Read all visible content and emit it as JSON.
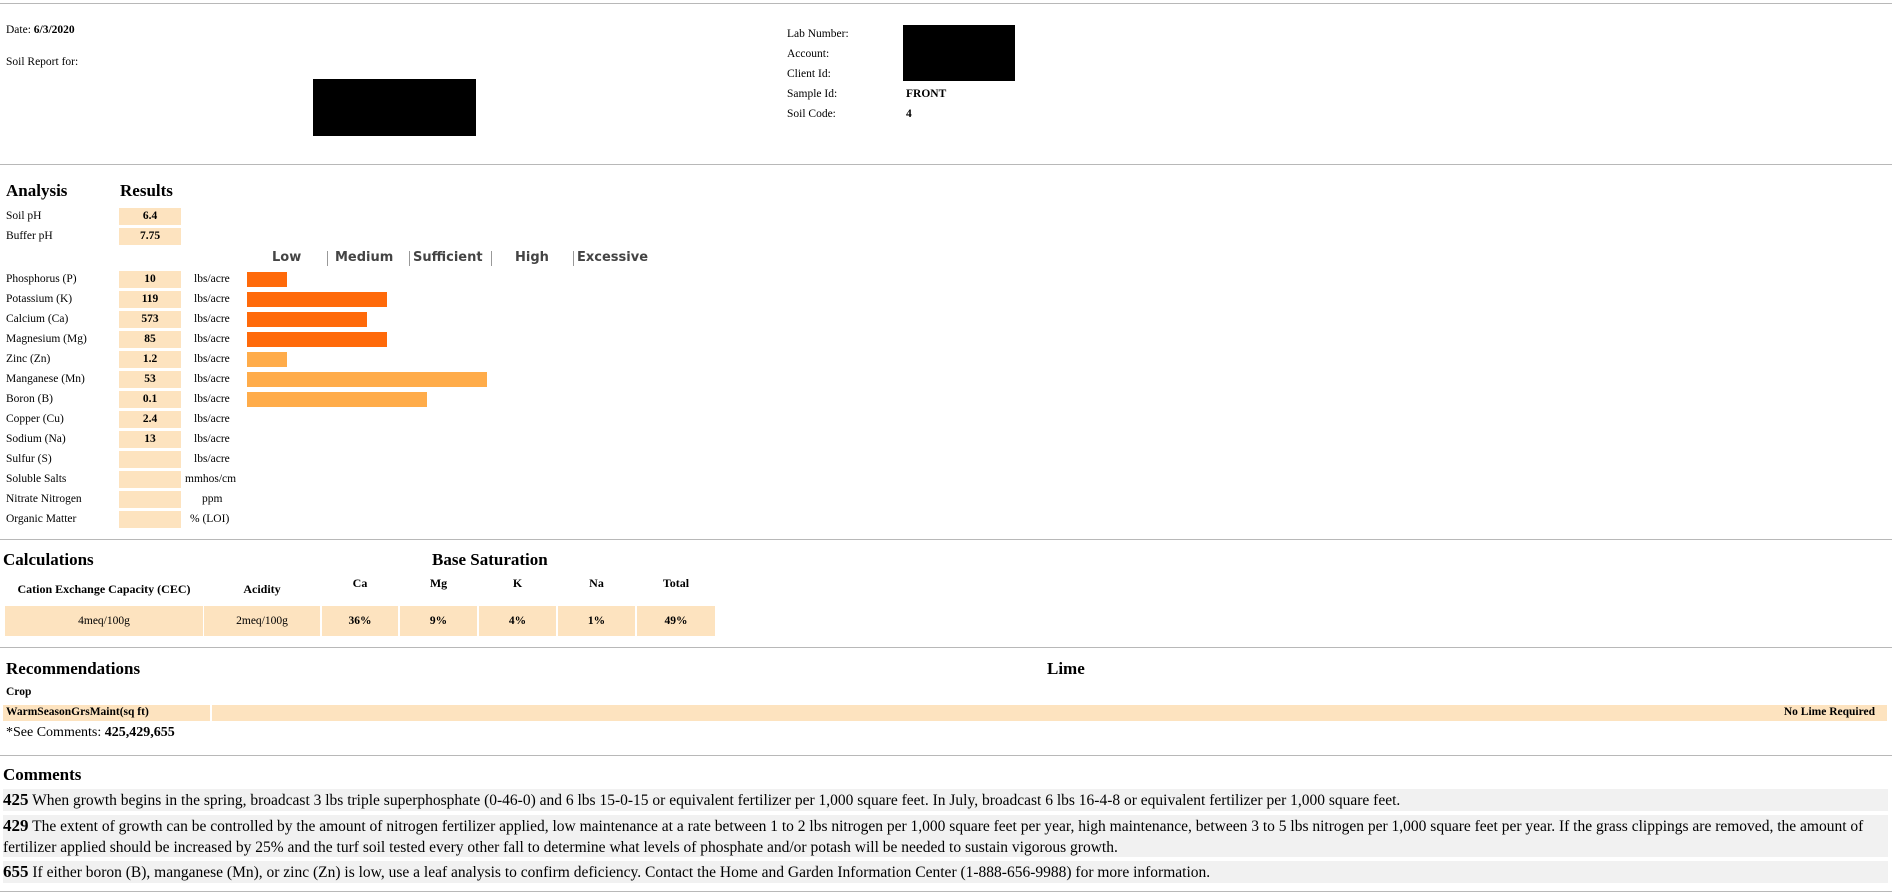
{
  "header": {
    "date_label": "Date:",
    "date_value": "6/3/2020",
    "soil_report_label": "Soil Report for:",
    "lab_number_label": "Lab Number:",
    "account_label": "Account:",
    "client_id_label": "Client Id:",
    "sample_id_label": "Sample Id:",
    "sample_id_value": "FRONT",
    "soil_code_label": "Soil Code:",
    "soil_code_value": "4"
  },
  "analysis": {
    "title": "Analysis",
    "results_title": "Results",
    "ph_rows": [
      {
        "label": "Soil pH",
        "value": "6.4"
      },
      {
        "label": "Buffer pH",
        "value": "7.75"
      }
    ],
    "scale_labels": [
      "Low",
      "Medium",
      "Sufficient",
      "High",
      "Excessive"
    ],
    "nutrients": [
      {
        "label": "Phosphorus (P)",
        "value": "10",
        "unit": "lbs/acre",
        "bar_level": 0.16,
        "bar_color": "#ff6a0a"
      },
      {
        "label": "Potassium (K)",
        "value": "119",
        "unit": "lbs/acre",
        "bar_level": 0.56,
        "bar_color": "#ff6a0a"
      },
      {
        "label": "Calcium (Ca)",
        "value": "573",
        "unit": "lbs/acre",
        "bar_level": 0.48,
        "bar_color": "#ff6a0a"
      },
      {
        "label": "Magnesium (Mg)",
        "value": "85",
        "unit": "lbs/acre",
        "bar_level": 0.56,
        "bar_color": "#ff6a0a"
      },
      {
        "label": "Zinc (Zn)",
        "value": "1.2",
        "unit": "lbs/acre",
        "bar_level": 0.16,
        "bar_color": "#ffac4a"
      },
      {
        "label": "Manganese (Mn)",
        "value": "53",
        "unit": "lbs/acre",
        "bar_level": 0.96,
        "bar_color": "#ffac4a"
      },
      {
        "label": "Boron (B)",
        "value": "0.1",
        "unit": "lbs/acre",
        "bar_level": 0.72,
        "bar_color": "#ffac4a"
      },
      {
        "label": "Copper (Cu)",
        "value": "2.4",
        "unit": "lbs/acre",
        "bar_level": 0,
        "bar_color": "#ffac4a"
      },
      {
        "label": "Sodium (Na)",
        "value": "13",
        "unit": "lbs/acre",
        "bar_level": 0,
        "bar_color": "#ffac4a"
      },
      {
        "label": "Sulfur (S)",
        "value": "",
        "unit": "lbs/acre",
        "bar_level": 0,
        "bar_color": "#ffac4a"
      },
      {
        "label": "Soluble Salts",
        "value": "",
        "unit": "mmhos/cm",
        "bar_level": 0,
        "bar_color": "#ffac4a"
      },
      {
        "label": "Nitrate Nitrogen",
        "value": "",
        "unit": "ppm",
        "bar_level": 0,
        "bar_color": "#ffac4a"
      },
      {
        "label": "Organic Matter",
        "value": "",
        "unit": "% (LOI)",
        "bar_level": 0,
        "bar_color": "#ffac4a"
      }
    ]
  },
  "calculations": {
    "title": "Calculations",
    "base_saturation_title": "Base Saturation",
    "cec_header": "Cation Exchange Capacity (CEC)",
    "acidity_header": "Acidity",
    "ca_header": "Ca",
    "mg_header": "Mg",
    "k_header": "K",
    "na_header": "Na",
    "total_header": "Total",
    "cec_value": "4meq/100g",
    "acidity_value": "2meq/100g",
    "ca_value": "36%",
    "mg_value": "9%",
    "k_value": "4%",
    "na_value": "1%",
    "total_value": "49%"
  },
  "recommendations": {
    "title": "Recommendations",
    "lime_title": "Lime",
    "crop_header": "Crop",
    "crop_value": "WarmSeasonGrsMaint(sq ft)",
    "lime_value": "No Lime Required",
    "see_comments_label": "*See Comments:",
    "see_comments_value": "425,429,655"
  },
  "comments": {
    "title": "Comments",
    "items": [
      {
        "number": "425",
        "text": "When growth begins in the spring, broadcast 3 lbs triple superphosphate (0-46-0) and 6 lbs 15-0-15 or equivalent fertilizer per 1,000 square feet. In July, broadcast 6 lbs 16-4-8 or equivalent fertilizer per 1,000 square feet."
      },
      {
        "number": "429",
        "text": "The extent of growth can be controlled by the amount of nitrogen fertilizer applied, low maintenance at a rate between 1 to 2 lbs nitrogen per 1,000 square feet per year, high maintenance, between 3 to 5 lbs nitrogen per 1,000 square feet per year. If the grass clippings are removed, the amount of fertilizer applied should be increased by 25% and the turf soil tested every other fall to determine what levels of phosphate and/or potash will be needed to sustain vigorous growth."
      },
      {
        "number": "655",
        "text": "If either boron (B), manganese (Mn), or zinc (Zn) is low, use a leaf analysis to confirm deficiency. Contact the Home and Garden Information Center (1-888-656-9988) for more information."
      }
    ]
  }
}
